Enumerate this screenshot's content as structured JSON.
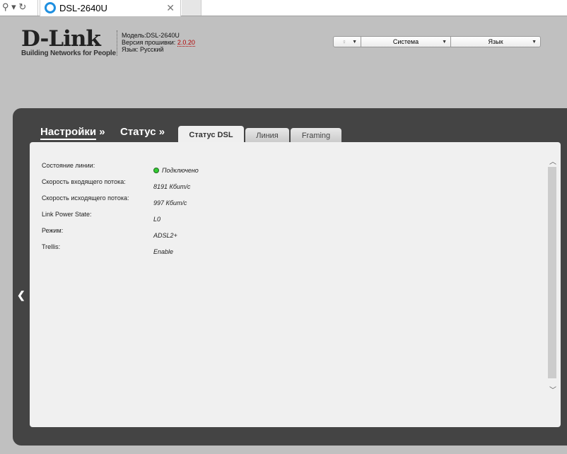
{
  "browser": {
    "tab_title": "DSL-2640U",
    "close": "✕"
  },
  "header": {
    "logo": "D-Link",
    "tagline": "Building Networks for People",
    "model": "Модель:DSL-2640U",
    "firmware_label": "Версия прошивки:",
    "firmware_version": "2.0.20",
    "language": "Язык: Русский"
  },
  "menu": {
    "system": "Система",
    "language": "Язык"
  },
  "nav": {
    "settings": "Настройки",
    "status": "Статус »",
    "sep": " »"
  },
  "tabs": [
    "Статус DSL",
    "Линия",
    "Framing"
  ],
  "status": {
    "rows": [
      {
        "label": "Состояние линии:",
        "value": "Подключено"
      },
      {
        "label": "Скорость входящего потока:",
        "value": "8191 Кбит/с"
      },
      {
        "label": "Скорость исходящего потока:",
        "value": "997 Кбит/с"
      },
      {
        "label": "Link Power State:",
        "value": "L0"
      },
      {
        "label": "Режим:",
        "value": "ADSL2+"
      },
      {
        "label": "Trellis:",
        "value": "Enable"
      }
    ],
    "connected_color": "#33cc33"
  }
}
